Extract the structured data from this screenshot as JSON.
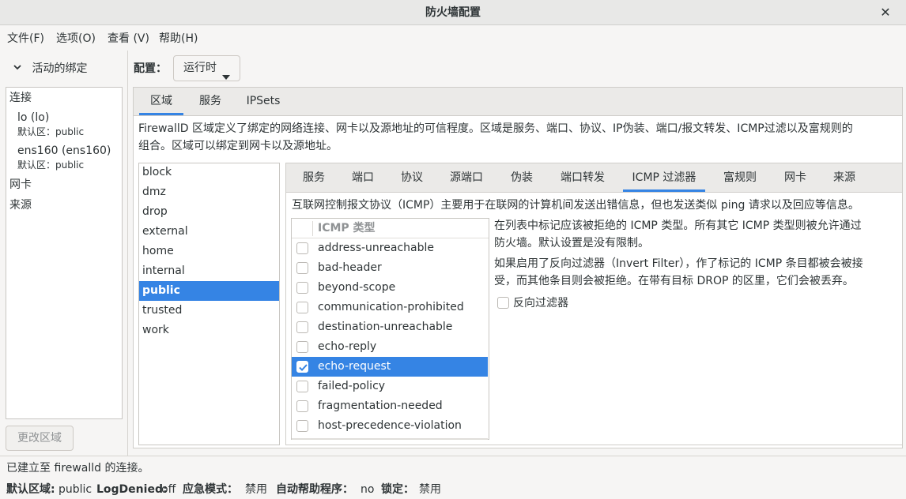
{
  "window": {
    "title": "防火墙配置"
  },
  "menu": [
    "文件(F)",
    "选项(O)",
    "查看 (V)",
    "帮助(H)"
  ],
  "left": {
    "header": "活动的绑定",
    "connections_label": "连接",
    "connections": [
      {
        "name": "lo (lo)",
        "zone": "默认区：public"
      },
      {
        "name": "ens160 (ens160)",
        "zone": "默认区：public"
      }
    ],
    "nic_label": "网卡",
    "source_label": "来源",
    "change_zone": "更改区域"
  },
  "config": {
    "label": "配置：",
    "value": "运行时"
  },
  "outer_tabs": [
    "区域",
    "服务",
    "IPSets"
  ],
  "zone_description_1": "FirewallD 区域定义了绑定的网络连接、网卡以及源地址的可信程度。区域是服务、端口、协议、IP伪装、端口/报文转发、ICMP过滤以及富规则的",
  "zone_description_2": "组合。区域可以绑定到网卡以及源地址。",
  "zones": [
    "block",
    "dmz",
    "drop",
    "external",
    "home",
    "internal",
    "public",
    "trusted",
    "work"
  ],
  "selected_zone": "public",
  "inner_tabs": [
    "服务",
    "端口",
    "协议",
    "源端口",
    "伪装",
    "端口转发",
    "ICMP 过滤器",
    "富规则",
    "网卡",
    "来源"
  ],
  "icmp": {
    "description": "互联网控制报文协议（ICMP）主要用于在联网的计算机间发送出错信息，但也发送类似 ping 请求以及回应等信息。",
    "column_header": "ICMP 类型",
    "types": [
      {
        "name": "address-unreachable",
        "checked": false
      },
      {
        "name": "bad-header",
        "checked": false
      },
      {
        "name": "beyond-scope",
        "checked": false
      },
      {
        "name": "communication-prohibited",
        "checked": false
      },
      {
        "name": "destination-unreachable",
        "checked": false
      },
      {
        "name": "echo-reply",
        "checked": false
      },
      {
        "name": "echo-request",
        "checked": true
      },
      {
        "name": "failed-policy",
        "checked": false
      },
      {
        "name": "fragmentation-needed",
        "checked": false
      },
      {
        "name": "host-precedence-violation",
        "checked": false
      }
    ],
    "info_1a": "在列表中标记应该被拒绝的 ICMP 类型。所有其它 ICMP 类型则被允许通过",
    "info_1b": "防火墙。默认设置是没有限制。",
    "info_2a": "如果启用了反向过滤器（Invert Filter），作了标记的 ICMP 条目都被会被接",
    "info_2b": "受，而其他条目则会被拒绝。在带有目标 DROP 的区里，它们会被丢弃。",
    "invert_filter": "反向过滤器"
  },
  "status": {
    "connection": "已建立至 firewalld 的连接。",
    "default_zone_k": "默认区域:",
    "default_zone_v": "public",
    "log_denied_k": "LogDenied:",
    "log_denied_v": "off",
    "panic_k": "应急模式：",
    "panic_v": "禁用",
    "auto_helper_k": "自动帮助程序：",
    "auto_helper_v": "no",
    "lockdown_k": "锁定：",
    "lockdown_v": "禁用"
  },
  "colors": {
    "accent": "#3584e4"
  }
}
